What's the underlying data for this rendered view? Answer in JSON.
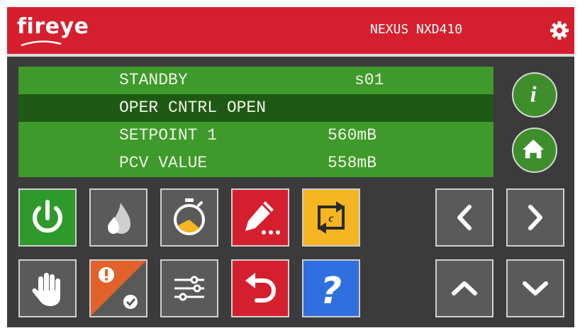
{
  "header": {
    "logo_text": "fireye",
    "model": "NEXUS NXD410",
    "settings_icon": "gear-icon"
  },
  "display": {
    "rows": [
      {
        "label": "STANDBY",
        "value": "s01",
        "selected": false
      },
      {
        "label": "OPER CNTRL OPEN",
        "value": "",
        "selected": true
      },
      {
        "label": "SETPOINT 1",
        "value": "560mB",
        "selected": false
      },
      {
        "label": "PCV VALUE",
        "value": "558mB",
        "selected": false
      }
    ]
  },
  "side_buttons": [
    {
      "icon": "info-icon"
    },
    {
      "icon": "home-icon"
    }
  ],
  "toolbar_row1": [
    {
      "icon": "power-icon",
      "color": "#2f9a2c"
    },
    {
      "icon": "flame-icon",
      "color": "#5a5a5a"
    },
    {
      "icon": "timer-icon",
      "color": "#5a5a5a"
    },
    {
      "icon": "edit-icon",
      "color": "#d61f2e"
    },
    {
      "icon": "cycle-icon",
      "color": "#f5b622"
    }
  ],
  "toolbar_row2": [
    {
      "icon": "hand-icon",
      "color": "#5a5a5a"
    },
    {
      "icon": "alarm-ack-icon",
      "color": "#e2622b"
    },
    {
      "icon": "sliders-icon",
      "color": "#5a5a5a"
    },
    {
      "icon": "undo-icon",
      "color": "#d61f2e"
    },
    {
      "icon": "help-icon",
      "color": "#2f6fe0"
    }
  ],
  "navigation": [
    {
      "icon": "chevron-left-icon"
    },
    {
      "icon": "chevron-right-icon"
    },
    {
      "icon": "chevron-up-icon"
    },
    {
      "icon": "chevron-down-icon"
    }
  ]
}
